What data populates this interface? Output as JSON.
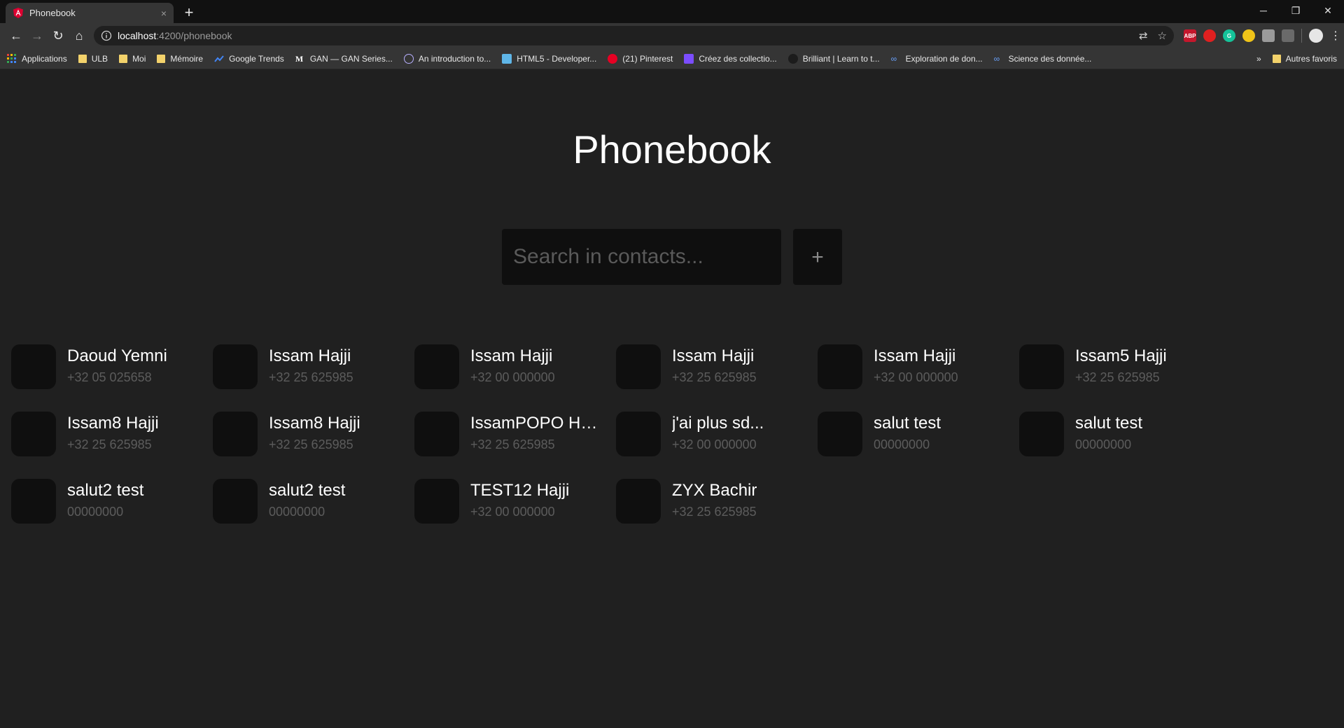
{
  "browser": {
    "tab_title": "Phonebook",
    "tab_close": "×",
    "new_tab": "+",
    "url_host": "localhost",
    "url_path": ":4200/phonebook",
    "bookmarks": [
      {
        "label": "Applications",
        "icon": "apps-grid-icon"
      },
      {
        "label": "ULB",
        "icon": "folder-icon"
      },
      {
        "label": "Moi",
        "icon": "folder-icon"
      },
      {
        "label": "Mémoire",
        "icon": "folder-icon"
      },
      {
        "label": "Google Trends",
        "icon": "trends-icon"
      },
      {
        "label": "GAN — GAN Series...",
        "icon": "medium-icon"
      },
      {
        "label": "An introduction to...",
        "icon": "site-icon"
      },
      {
        "label": "HTML5 - Developer...",
        "icon": "site-icon"
      },
      {
        "label": "(21) Pinterest",
        "icon": "pinterest-icon"
      },
      {
        "label": "Créez des collectio...",
        "icon": "site-icon"
      },
      {
        "label": "Brilliant | Learn to t...",
        "icon": "site-icon"
      },
      {
        "label": "Exploration de don...",
        "icon": "coursera-icon"
      },
      {
        "label": "Science des donnée...",
        "icon": "coursera-icon"
      }
    ],
    "bookmarks_overflow": "»",
    "other_bookmarks": "Autres favoris"
  },
  "page": {
    "title": "Phonebook",
    "search_placeholder": "Search in contacts...",
    "add_label": "+"
  },
  "contacts": [
    {
      "name": "Daoud Yemni",
      "phone": "+32 05 025658"
    },
    {
      "name": "Issam Hajji",
      "phone": "+32 25 625985"
    },
    {
      "name": "Issam Hajji",
      "phone": "+32 00 000000"
    },
    {
      "name": "Issam Hajji",
      "phone": "+32 25 625985"
    },
    {
      "name": "Issam Hajji",
      "phone": "+32 00 000000"
    },
    {
      "name": "Issam5 Hajji",
      "phone": "+32 25 625985"
    },
    {
      "name": "Issam8 Hajji",
      "phone": "+32 25 625985"
    },
    {
      "name": "Issam8 Hajji",
      "phone": "+32 25 625985"
    },
    {
      "name": "IssamPOPO Ha...",
      "phone": "+32 25 625985"
    },
    {
      "name": "j'ai plus sd...",
      "phone": "+32 00 000000"
    },
    {
      "name": "salut test",
      "phone": "00000000"
    },
    {
      "name": "salut test",
      "phone": "00000000"
    },
    {
      "name": "salut2 test",
      "phone": "00000000"
    },
    {
      "name": "salut2 test",
      "phone": "00000000"
    },
    {
      "name": "TEST12 Hajji",
      "phone": "+32 00 000000"
    },
    {
      "name": "ZYX Bachir",
      "phone": "+32 25 625985"
    }
  ],
  "colors": {
    "background": "#202020",
    "card": "#0f0f0f",
    "text": "#ffffff",
    "muted": "#5c5c5c",
    "angular_red": "#dd0031"
  }
}
